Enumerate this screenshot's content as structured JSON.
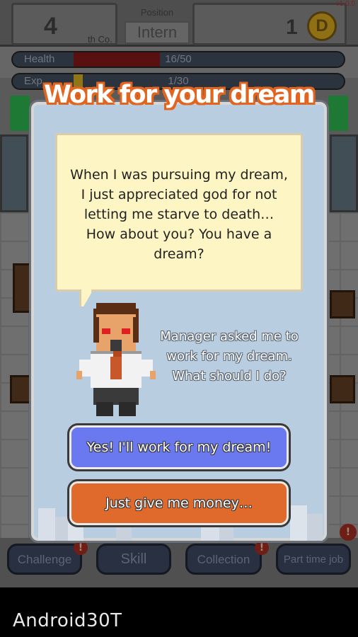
{
  "hud": {
    "company_number": "4",
    "company_suffix": "th Co.",
    "position_label": "Position",
    "position_value": "Intern",
    "coins": "1",
    "coin_symbol": "D",
    "version": "v1.0.0",
    "health": {
      "label": "Health",
      "value": "16/50",
      "fraction": 0.32
    },
    "exp": {
      "label": "Exp",
      "value": "1/30",
      "fraction": 0.033
    }
  },
  "dialog": {
    "title": "Work for your dream",
    "speech": "When I was pursuing my dream, I just appreciated god for not letting me starve to death… How about you?  You have a dream?",
    "narration": "Manager asked me to work for my dream. What should I do?",
    "choices": {
      "dream": "Yes! I'll work for my dream!",
      "money": "Just give me money…"
    }
  },
  "nav": {
    "challenge": "Challenge",
    "skill": "Skill",
    "collection": "Collection",
    "part_time_job": "Part time job",
    "badge": "!"
  },
  "watermark": "Android30T",
  "colors": {
    "title_outline": "#e2651f",
    "dream_button": "#6a79f0",
    "money_button": "#e06a2c",
    "dialog_bg": "#b8cde0",
    "bubble_bg": "#fdf5c3"
  },
  "icons": {
    "coin": "coin-icon",
    "manager": "manager-sprite"
  }
}
